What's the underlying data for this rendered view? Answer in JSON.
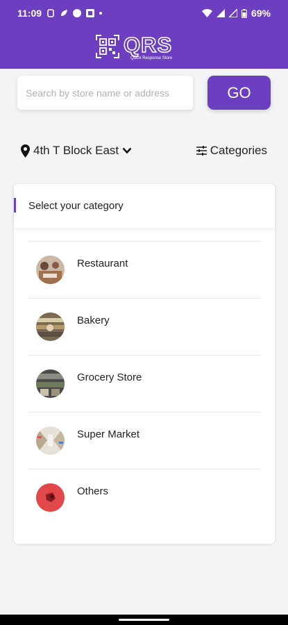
{
  "status": {
    "time": "11:09",
    "battery": "69%"
  },
  "brand": {
    "name": "QRS",
    "tagline": "Quick Response Store"
  },
  "search": {
    "placeholder": "Search by store name or address",
    "value": "",
    "go_label": "GO"
  },
  "location": {
    "label": "4th T Block East"
  },
  "categories_button": {
    "label": "Categories"
  },
  "panel": {
    "title": "Select your category",
    "items": [
      {
        "label": "Restaurant",
        "icon": "restaurant-photo"
      },
      {
        "label": "Bakery",
        "icon": "bakery-photo"
      },
      {
        "label": "Grocery Store",
        "icon": "grocery-photo"
      },
      {
        "label": "Super Market",
        "icon": "supermarket-photo"
      },
      {
        "label": "Others",
        "icon": "others-photo"
      }
    ]
  },
  "colors": {
    "brand": "#6c3fc0",
    "background": "#f3f4f6",
    "others_avatar": "#e0484a"
  }
}
